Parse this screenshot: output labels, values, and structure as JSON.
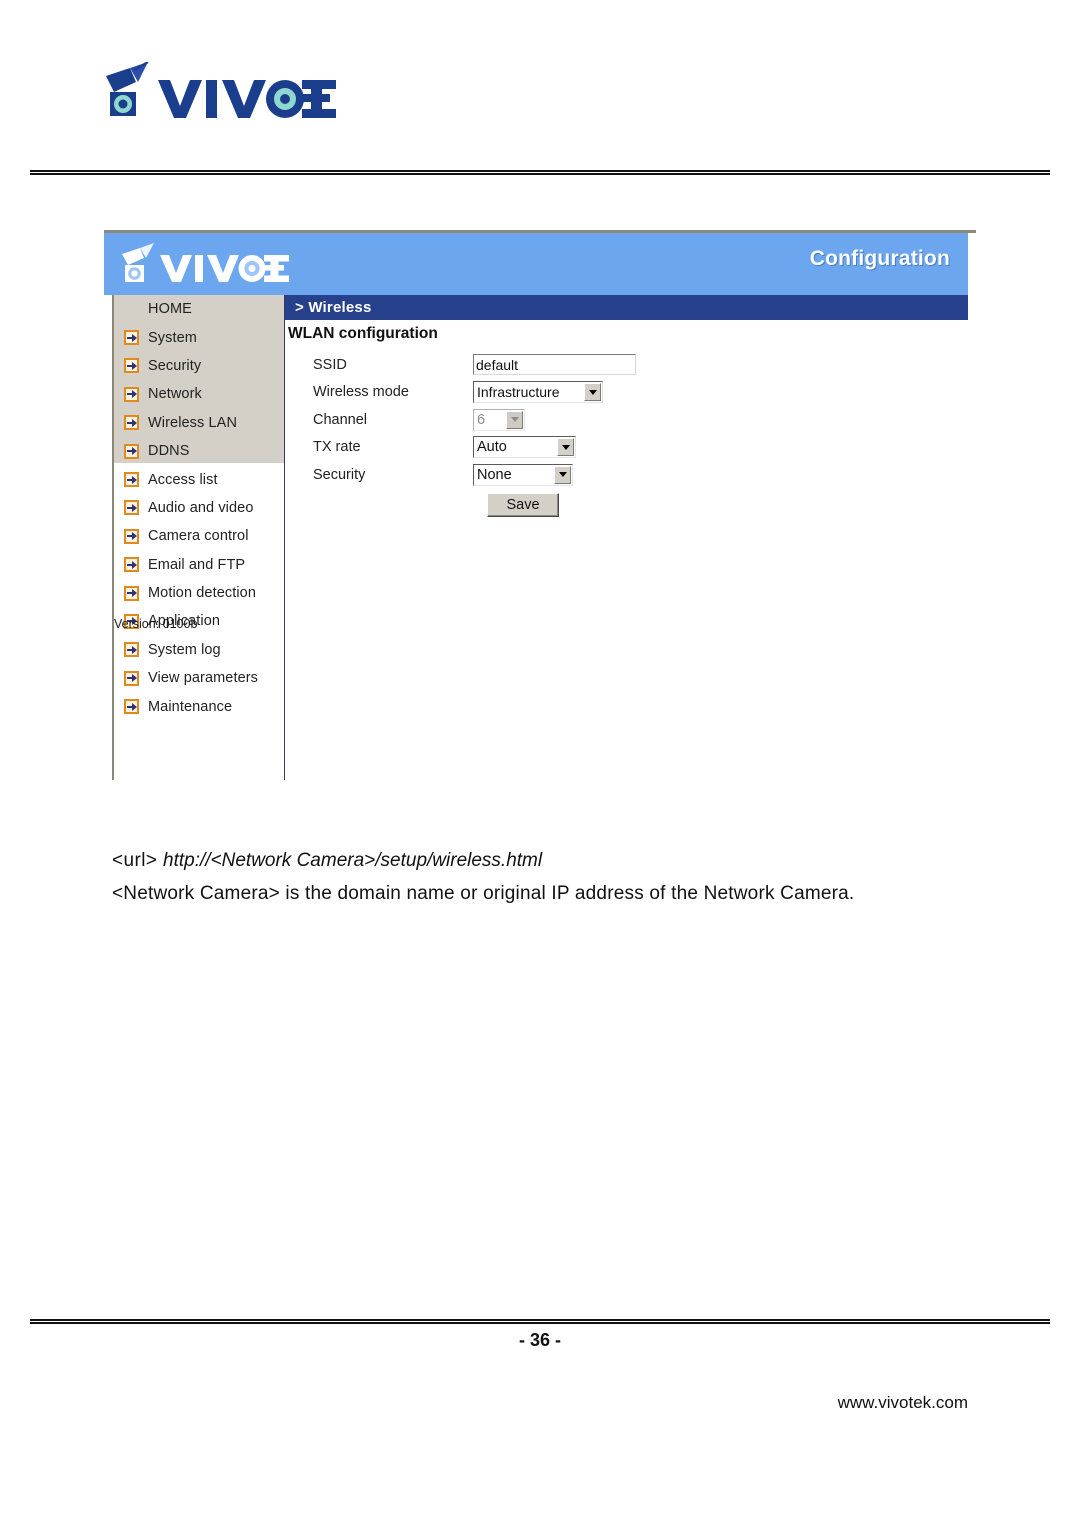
{
  "document": {
    "brand_name": "VIVOTEK",
    "page_number": "- 36 -",
    "site_url": "www.vivotek.com"
  },
  "screenshot": {
    "header": {
      "logo_text": "VIVOTEK",
      "title": "Configuration"
    },
    "section_bar": {
      "label": "> Wireless"
    },
    "form_title": "WLAN configuration",
    "sidebar": {
      "items": [
        {
          "label": "HOME",
          "icon": "none"
        },
        {
          "label": "System",
          "icon": "arrow-right-icon"
        },
        {
          "label": "Security",
          "icon": "arrow-right-icon"
        },
        {
          "label": "Network",
          "icon": "arrow-right-icon"
        },
        {
          "label": "Wireless LAN",
          "icon": "arrow-right-icon"
        },
        {
          "label": "DDNS",
          "icon": "arrow-right-icon"
        },
        {
          "label": "Access list",
          "icon": "arrow-right-icon"
        },
        {
          "label": "Audio and video",
          "icon": "arrow-right-icon"
        },
        {
          "label": "Camera control",
          "icon": "arrow-right-icon"
        },
        {
          "label": "Email and FTP",
          "icon": "arrow-right-icon"
        },
        {
          "label": "Motion detection",
          "icon": "arrow-right-icon"
        },
        {
          "label": "Application",
          "icon": "arrow-right-icon"
        },
        {
          "label": "System log",
          "icon": "arrow-right-icon"
        },
        {
          "label": "View parameters",
          "icon": "arrow-right-icon"
        },
        {
          "label": "Maintenance",
          "icon": "arrow-right-icon"
        }
      ],
      "version": "Version: 0100b"
    },
    "form": {
      "ssid": {
        "label": "SSID",
        "value": "default"
      },
      "wireless_mode": {
        "label": "Wireless mode",
        "value": "Infrastructure"
      },
      "channel": {
        "label": "Channel",
        "value": "6"
      },
      "tx_rate": {
        "label": "TX rate",
        "value": "Auto"
      },
      "security": {
        "label": "Security",
        "value": "None"
      },
      "save_label": "Save"
    },
    "colors": {
      "header_blue": "#6ba6ef",
      "section_bar_blue": "#27408b",
      "sidebar_gray": "#d4d0c8",
      "arrow_orange": "#e08a1e",
      "arrow_navy": "#2d3377"
    }
  },
  "caption": {
    "url_prefix": "<url> ",
    "url_value": "http://<Network Camera>/setup/wireless.html",
    "note": "<Network Camera> is the domain name or original IP address of the Network Camera."
  }
}
